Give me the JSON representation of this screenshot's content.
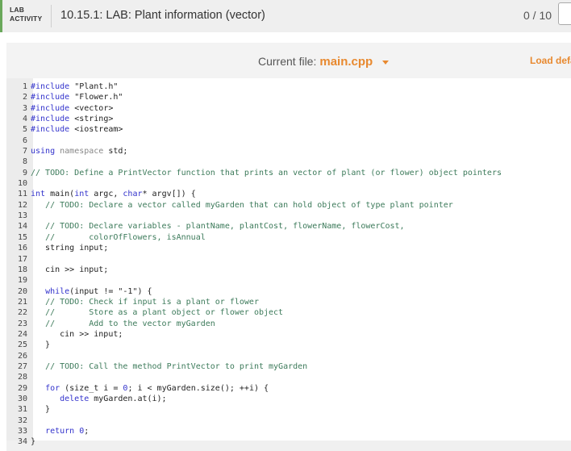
{
  "header": {
    "lab_tag_line1": "LAB",
    "lab_tag_line2": "ACTIVITY",
    "title": "10.15.1: LAB: Plant information (vector)",
    "score": "0 / 10"
  },
  "toolbar": {
    "current_file_label": "Current file:",
    "current_file": "main.cpp",
    "load_default": "Load defa"
  },
  "accent_color": "#e8892f",
  "code": [
    {
      "n": "1",
      "t": "#include \"Plant.h\""
    },
    {
      "n": "2",
      "t": "#include \"Flower.h\""
    },
    {
      "n": "3",
      "t": "#include <vector>"
    },
    {
      "n": "4",
      "t": "#include <string>"
    },
    {
      "n": "5",
      "t": "#include <iostream>"
    },
    {
      "n": "6",
      "t": ""
    },
    {
      "n": "7",
      "t": "using namespace std;"
    },
    {
      "n": "8",
      "t": ""
    },
    {
      "n": "9",
      "t": "// TODO: Define a PrintVector function that prints an vector of plant (or flower) object pointers"
    },
    {
      "n": "10",
      "t": ""
    },
    {
      "n": "11",
      "t": "int main(int argc, char* argv[]) {"
    },
    {
      "n": "12",
      "t": "   // TODO: Declare a vector called myGarden that can hold object of type plant pointer"
    },
    {
      "n": "13",
      "t": ""
    },
    {
      "n": "14",
      "t": "   // TODO: Declare variables - plantName, plantCost, flowerName, flowerCost,"
    },
    {
      "n": "15",
      "t": "   //       colorOfFlowers, isAnnual"
    },
    {
      "n": "16",
      "t": "   string input;"
    },
    {
      "n": "17",
      "t": ""
    },
    {
      "n": "18",
      "t": "   cin >> input;"
    },
    {
      "n": "19",
      "t": ""
    },
    {
      "n": "20",
      "t": "   while(input != \"-1\") {"
    },
    {
      "n": "21",
      "t": "   // TODO: Check if input is a plant or flower"
    },
    {
      "n": "22",
      "t": "   //       Store as a plant object or flower object"
    },
    {
      "n": "23",
      "t": "   //       Add to the vector myGarden"
    },
    {
      "n": "24",
      "t": "      cin >> input;"
    },
    {
      "n": "25",
      "t": "   }"
    },
    {
      "n": "26",
      "t": ""
    },
    {
      "n": "27",
      "t": "   // TODO: Call the method PrintVector to print myGarden"
    },
    {
      "n": "28",
      "t": ""
    },
    {
      "n": "29",
      "t": "   for (size_t i = 0; i < myGarden.size(); ++i) {"
    },
    {
      "n": "30",
      "t": "      delete myGarden.at(i);"
    },
    {
      "n": "31",
      "t": "   }"
    },
    {
      "n": "32",
      "t": ""
    },
    {
      "n": "33",
      "t": "   return 0;"
    },
    {
      "n": "34",
      "t": "}"
    }
  ]
}
